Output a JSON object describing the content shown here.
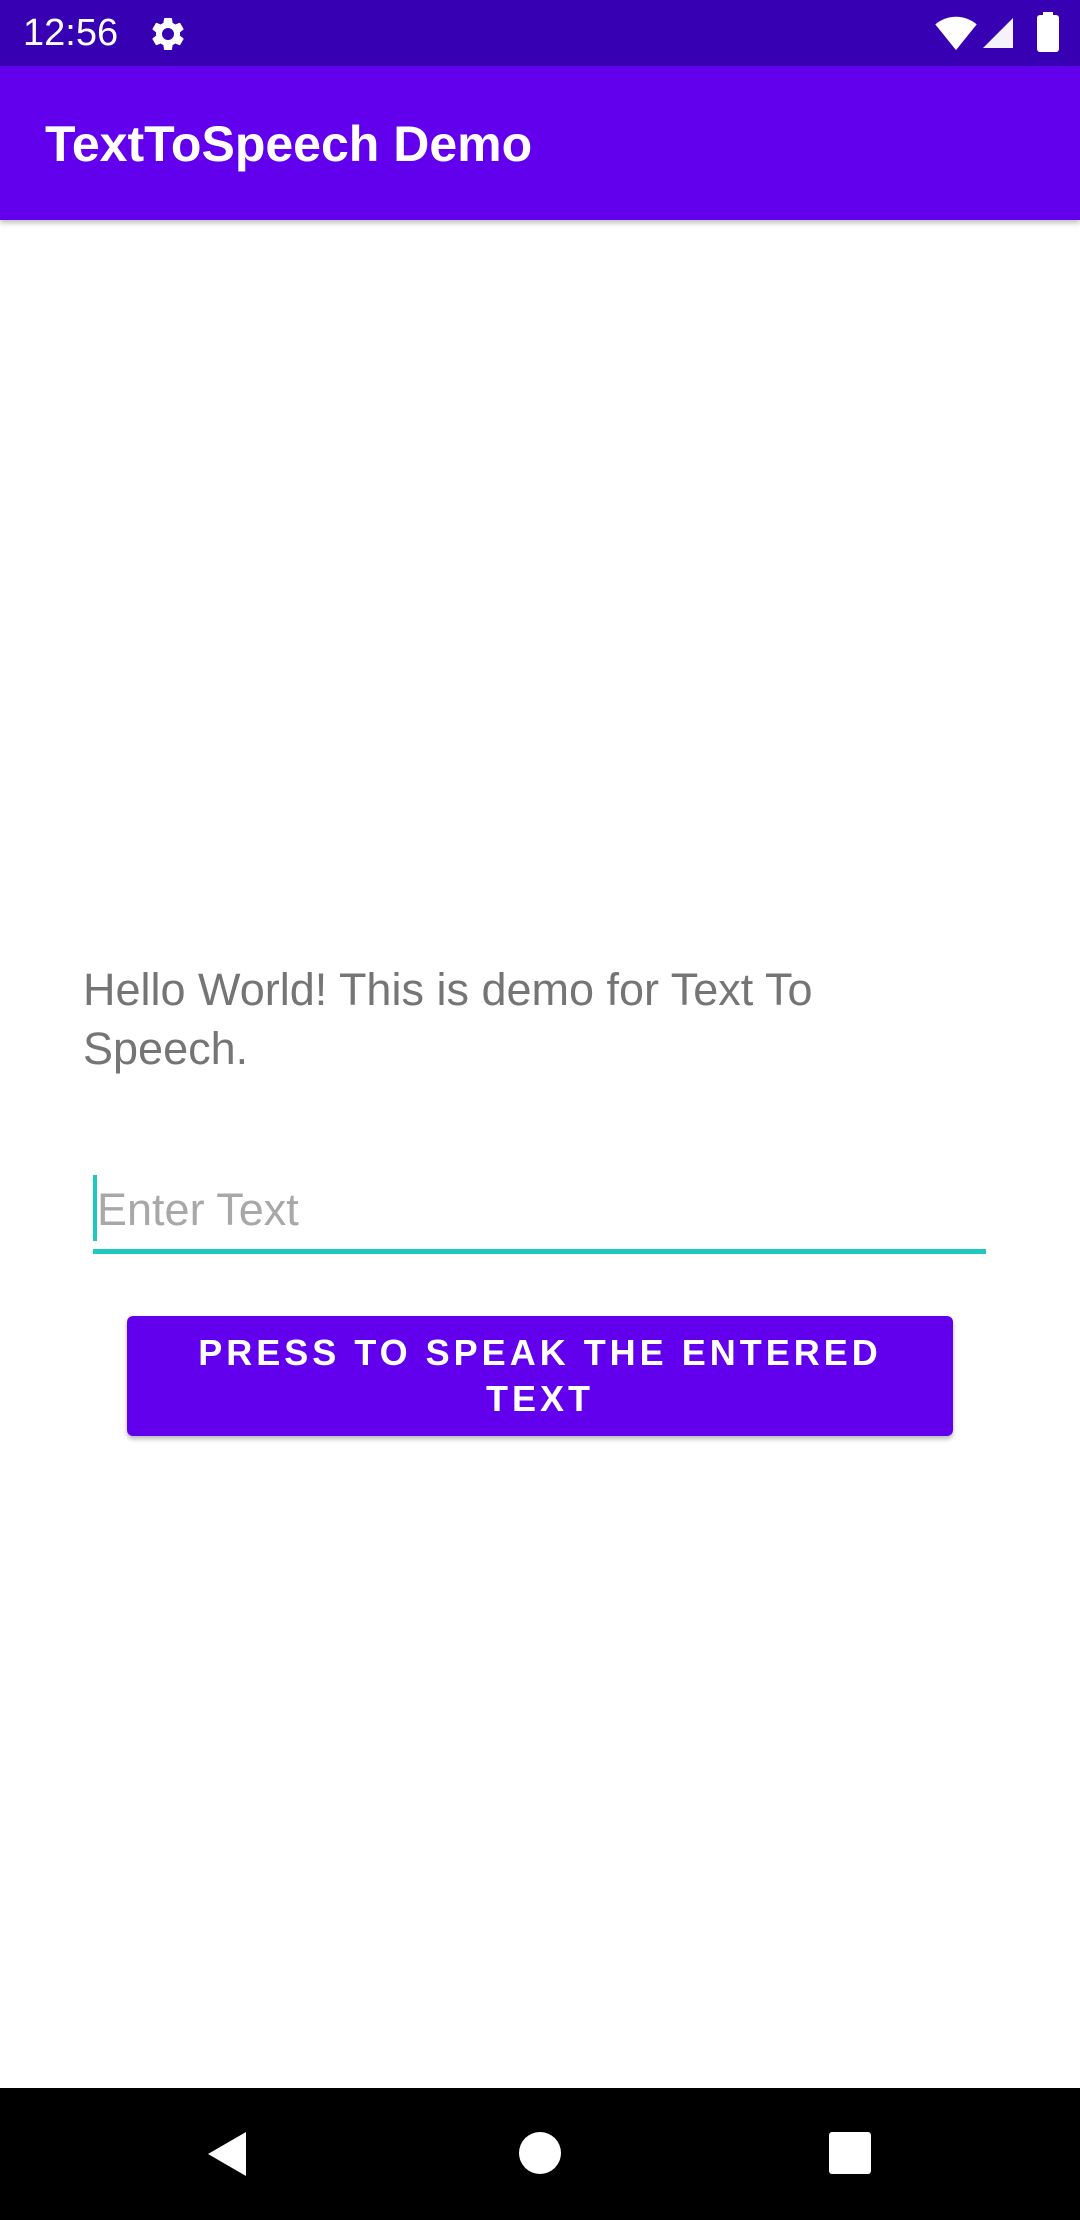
{
  "status_bar": {
    "time": "12:56",
    "icons": [
      "gear-icon",
      "wifi-icon",
      "signal-icon",
      "battery-icon"
    ]
  },
  "app_bar": {
    "title": "TextToSpeech Demo"
  },
  "main": {
    "message": "Hello World! This is demo for Text To Speech.",
    "input": {
      "value": "",
      "placeholder": "Enter Text"
    },
    "speak_button_label": "PRESS TO SPEAK THE ENTERED TEXT"
  },
  "nav_bar": {
    "icons": [
      "back-icon",
      "home-icon",
      "recents-icon"
    ]
  },
  "colors": {
    "status_bar": "#3700b3",
    "primary": "#6200ee",
    "accent": "#1ec9c0",
    "body_text": "#757575",
    "placeholder": "#a8a8a8",
    "nav_bar": "#000000"
  }
}
